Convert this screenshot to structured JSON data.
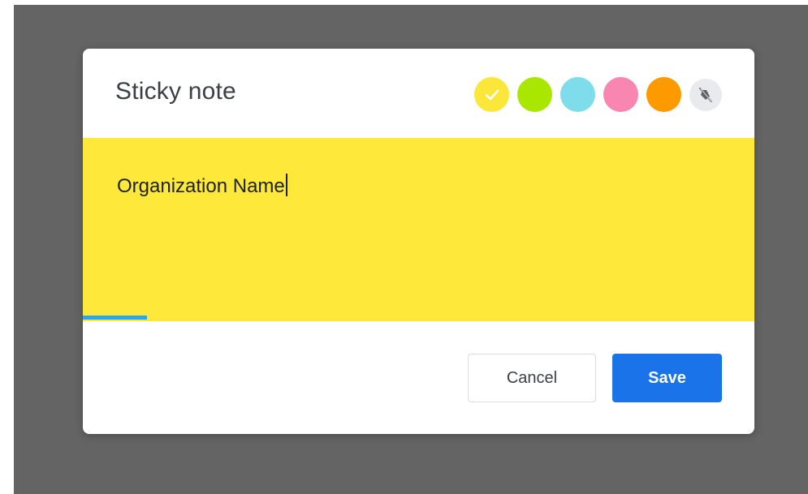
{
  "dialog": {
    "title": "Sticky note",
    "note_text": "Organization Name",
    "cancel_label": "Cancel",
    "save_label": "Save",
    "progress_fraction": 0.095
  },
  "swatches": [
    {
      "name": "yellow",
      "color": "#fbe73a",
      "selected": true
    },
    {
      "name": "green",
      "color": "#aae700"
    },
    {
      "name": "cyan",
      "color": "#7fdcea"
    },
    {
      "name": "pink",
      "color": "#f986b0"
    },
    {
      "name": "orange",
      "color": "#fd9a00"
    },
    {
      "name": "none",
      "icon": "no-color-icon",
      "color": "#e8eaed"
    }
  ],
  "colors": {
    "backdrop": "#646464",
    "note_background": "#fee93a",
    "progress": "#29a6f3",
    "save_button": "#1a73e8"
  }
}
